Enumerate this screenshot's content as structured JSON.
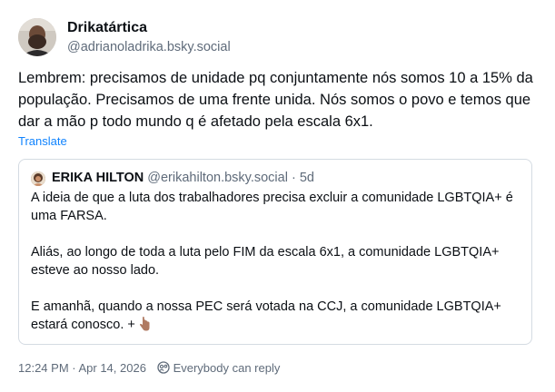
{
  "post": {
    "author_name": "Drikatártica",
    "author_handle": "@adrianoladrika.bsky.social",
    "text": "Lembrem: precisamos de unidade pq conjuntamente nós somos 10 a 15% da população. Precisamos de uma frente unida. Nós somos o povo e temos que dar a mão p todo mundo q é afetado pela escala 6x1.",
    "translate_label": "Translate"
  },
  "quote": {
    "author_name": "ERIKA HILTON",
    "author_handle": "@erikahilton.bsky.social",
    "separator": "·",
    "age": "5d",
    "paragraphs": [
      "A ideia de que a luta dos trabalhadores precisa excluir a comunidade LGBTQIA+ é uma FARSA.",
      "Aliás, ao longo de toda a luta pelo FIM da escala 6x1, a comunidade LGBTQIA+ esteve ao nosso lado.",
      "E amanhã, quando a nossa PEC será votada na CCJ, a comunidade LGBTQIA+ estará conosco. +"
    ],
    "trailing_icon": "pointing-down-hand-emoji"
  },
  "meta": {
    "timestamp": "12:24 PM · Apr 14, 2026",
    "reply_setting": "Everybody can reply",
    "reply_icon": "reply-permission-icon"
  },
  "colors": {
    "link": "#1083fe",
    "muted": "#5f6b7a",
    "border": "#d4dbe2",
    "text": "#0b0f14"
  }
}
